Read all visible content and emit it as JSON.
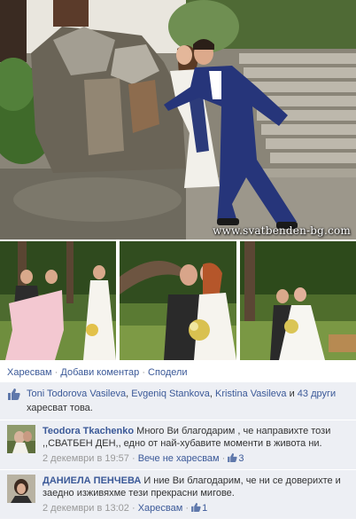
{
  "photo": {
    "watermark": "www.svatbenden-bg.com"
  },
  "actions": {
    "like": "Харесвам",
    "comment": "Добави коментар",
    "share": "Сподели",
    "separator": "·"
  },
  "likes": {
    "names": [
      "Toni Todorova Vasileva",
      "Evgeniq Stankova",
      "Kristina Vasileva"
    ],
    "comma": ", ",
    "and": " и ",
    "others": "43 други",
    "suffix": "харесват това."
  },
  "comments": [
    {
      "author": "Teodora Tkachenko",
      "text": "Много Ви благодарим , че направихте този ,,СВАТБЕН ДЕН,, едно от най-хубавите моменти в живота ни.",
      "time": "2 декември в 19:57",
      "action": "Вече не харесвам",
      "like_count": "3"
    },
    {
      "author": "ДАНИЕЛА ПЕНЧЕВА",
      "text": "И ние Ви благодарим, че ни се доверихте и заедно изживяхме тези прекрасни мигове.",
      "time": "2 декември в 13:02",
      "action": "Харесвам",
      "like_count": "1"
    }
  ],
  "colors": {
    "link": "#3b5998",
    "feedback_bg": "#edeff4",
    "meta": "#999999"
  },
  "icons": {
    "like": "thumbs-up-icon"
  }
}
